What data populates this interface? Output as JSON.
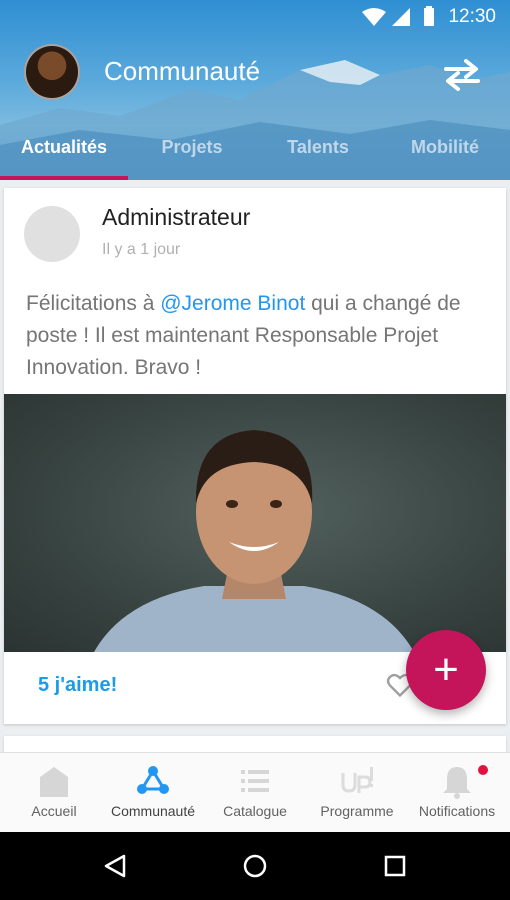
{
  "status_bar": {
    "time": "12:30"
  },
  "header": {
    "title": "Communauté",
    "tabs": [
      {
        "label": "Actualités",
        "active": true
      },
      {
        "label": "Projets",
        "active": false
      },
      {
        "label": "Talents",
        "active": false
      },
      {
        "label": "Mobilité",
        "active": false
      }
    ]
  },
  "post": {
    "author": "Administrateur",
    "time": "Il y a 1 jour",
    "text_before": "Félicitations à ",
    "mention": "@Jerome Binot",
    "text_after": " qui a changé de poste ! Il est maintenant Responsable Projet Innovation. Bravo !",
    "likes": "5 j'aime!"
  },
  "fab": {
    "icon": "plus-icon",
    "label": "+"
  },
  "bottom_nav": [
    {
      "label": "Accueil",
      "icon": "home-icon"
    },
    {
      "label": "Communauté",
      "icon": "community-icon",
      "active": true
    },
    {
      "label": "Catalogue",
      "icon": "list-icon"
    },
    {
      "label": "Programme",
      "icon": "up-logo-icon"
    },
    {
      "label": "Notifications",
      "icon": "bell-icon",
      "badge": true
    }
  ],
  "colors": {
    "accent": "#c4145a",
    "link": "#1e9be6",
    "header": "#3f9ad6"
  }
}
